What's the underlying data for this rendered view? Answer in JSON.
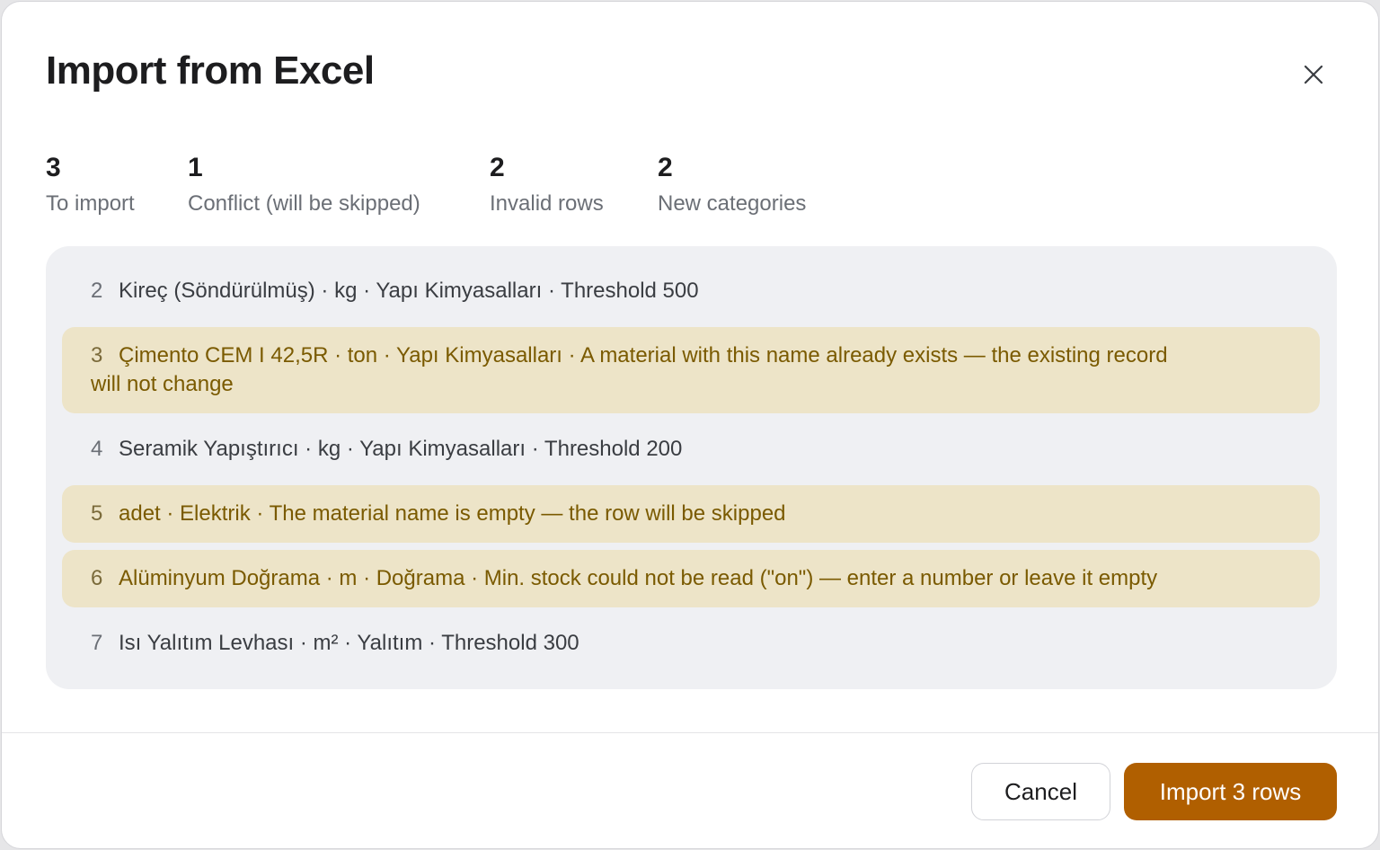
{
  "dialog": {
    "title": "Import from Excel",
    "close_icon": "close-icon"
  },
  "stats": [
    {
      "count": "3",
      "label": "To import"
    },
    {
      "count": "1",
      "label": "Conflict (will be skipped)"
    },
    {
      "count": "2",
      "label": "Invalid rows"
    },
    {
      "count": "2",
      "label": "New categories"
    }
  ],
  "rows": [
    {
      "index": "2",
      "text": "Kireç (Söndürülmüş) · kg · Yapı Kimyasalları  · Threshold 500",
      "status": "ok"
    },
    {
      "index": "3",
      "text": "Çimento CEM I 42,5R · ton · Yapı Kimyasalları  · A material with this name already exists — the existing record",
      "text_line2": "will not change",
      "status": "warning"
    },
    {
      "index": "4",
      "text": "Seramik Yapıştırıcı · kg · Yapı Kimyasalları  · Threshold 200",
      "status": "ok"
    },
    {
      "index": "5",
      "text": "adet · Elektrik  · The material name is empty — the row will be skipped",
      "status": "warning"
    },
    {
      "index": "6",
      "text": "Alüminyum Doğrama · m · Doğrama  · Min. stock could not be read (\"on\") — enter a number or leave it empty",
      "status": "warning"
    },
    {
      "index": "7",
      "text": "Isı Yalıtım Levhası · m² · Yalıtım  · Threshold 300",
      "status": "ok"
    }
  ],
  "footer": {
    "cancel_label": "Cancel",
    "import_label": "Import 3 rows"
  },
  "colors": {
    "primary": "#b05f00",
    "warning_bg": "#ede4c8",
    "warning_text": "#7a5a00",
    "list_bg": "#eff0f3"
  }
}
